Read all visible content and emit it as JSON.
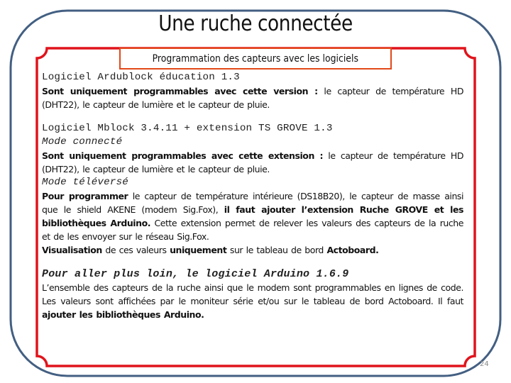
{
  "slide": {
    "title": "Une ruche connectée",
    "subtitle": "Programmation des capteurs avec les logiciels",
    "page_number": "24",
    "colors": {
      "outer_frame": "#435f82",
      "inner_frame": "#e0141c",
      "subtitle_border": "#e2481a"
    }
  },
  "sections": {
    "ardublock": {
      "heading": "Logiciel Ardublock éducation 1.3",
      "text": {
        "b1": "Sont uniquement programmables avec cette version :",
        "t1": " le capteur de température HD (DHT22), le capteur de lumière et le capteur de pluie."
      }
    },
    "mblock": {
      "heading": "Logiciel Mblock 3.4.11 + extension TS GROVE 1.3",
      "mode_connected": {
        "label": "Mode connecté",
        "b1": "Sont uniquement programmables avec cette extension :",
        "t1": " le capteur de température HD (DHT22), le capteur de lumière et le capteur de pluie."
      },
      "mode_upload": {
        "label": "Mode téléversé",
        "b1": "Pour programmer",
        "t1": " le capteur de température intérieure (DS18B20), le capteur de masse ainsi que le shield AKENE (modem Sig.Fox), ",
        "b2": "il faut ajouter l’extension Ruche GROVE et les bibliothèques Arduino.",
        "t2": " Cette extension permet de relever les valeurs des capteurs de la ruche et de les envoyer sur le réseau Sig.Fox.",
        "b3": "Visualisation",
        "t3": " de ces valeurs ",
        "b4": "uniquement",
        "t4": " sur le tableau de bord ",
        "b5": "Actoboard."
      }
    },
    "arduino": {
      "heading": "Pour aller plus loin, le logiciel Arduino 1.6.9",
      "t1": "L’ensemble des capteurs de la ruche ainsi que le modem sont programmables en lignes de code. Les valeurs sont affichées par le moniteur série et/ou sur le tableau de bord Actoboard. Il faut ",
      "b1": "ajouter les bibliothèques Arduino."
    }
  }
}
